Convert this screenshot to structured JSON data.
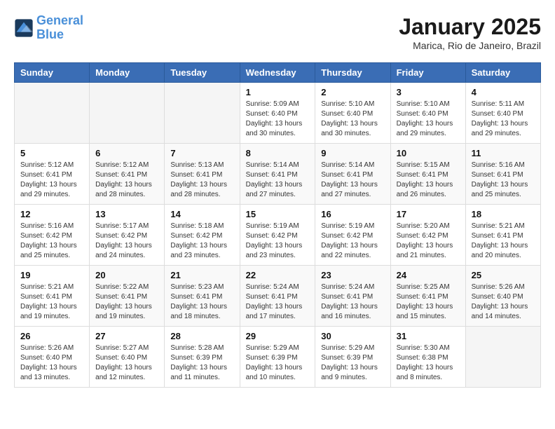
{
  "header": {
    "logo_line1": "General",
    "logo_line2": "Blue",
    "month_title": "January 2025",
    "location": "Marica, Rio de Janeiro, Brazil"
  },
  "weekdays": [
    "Sunday",
    "Monday",
    "Tuesday",
    "Wednesday",
    "Thursday",
    "Friday",
    "Saturday"
  ],
  "weeks": [
    [
      {
        "day": "",
        "sunrise": "",
        "sunset": "",
        "daylight": ""
      },
      {
        "day": "",
        "sunrise": "",
        "sunset": "",
        "daylight": ""
      },
      {
        "day": "",
        "sunrise": "",
        "sunset": "",
        "daylight": ""
      },
      {
        "day": "1",
        "sunrise": "Sunrise: 5:09 AM",
        "sunset": "Sunset: 6:40 PM",
        "daylight": "Daylight: 13 hours and 30 minutes."
      },
      {
        "day": "2",
        "sunrise": "Sunrise: 5:10 AM",
        "sunset": "Sunset: 6:40 PM",
        "daylight": "Daylight: 13 hours and 30 minutes."
      },
      {
        "day": "3",
        "sunrise": "Sunrise: 5:10 AM",
        "sunset": "Sunset: 6:40 PM",
        "daylight": "Daylight: 13 hours and 29 minutes."
      },
      {
        "day": "4",
        "sunrise": "Sunrise: 5:11 AM",
        "sunset": "Sunset: 6:40 PM",
        "daylight": "Daylight: 13 hours and 29 minutes."
      }
    ],
    [
      {
        "day": "5",
        "sunrise": "Sunrise: 5:12 AM",
        "sunset": "Sunset: 6:41 PM",
        "daylight": "Daylight: 13 hours and 29 minutes."
      },
      {
        "day": "6",
        "sunrise": "Sunrise: 5:12 AM",
        "sunset": "Sunset: 6:41 PM",
        "daylight": "Daylight: 13 hours and 28 minutes."
      },
      {
        "day": "7",
        "sunrise": "Sunrise: 5:13 AM",
        "sunset": "Sunset: 6:41 PM",
        "daylight": "Daylight: 13 hours and 28 minutes."
      },
      {
        "day": "8",
        "sunrise": "Sunrise: 5:14 AM",
        "sunset": "Sunset: 6:41 PM",
        "daylight": "Daylight: 13 hours and 27 minutes."
      },
      {
        "day": "9",
        "sunrise": "Sunrise: 5:14 AM",
        "sunset": "Sunset: 6:41 PM",
        "daylight": "Daylight: 13 hours and 27 minutes."
      },
      {
        "day": "10",
        "sunrise": "Sunrise: 5:15 AM",
        "sunset": "Sunset: 6:41 PM",
        "daylight": "Daylight: 13 hours and 26 minutes."
      },
      {
        "day": "11",
        "sunrise": "Sunrise: 5:16 AM",
        "sunset": "Sunset: 6:41 PM",
        "daylight": "Daylight: 13 hours and 25 minutes."
      }
    ],
    [
      {
        "day": "12",
        "sunrise": "Sunrise: 5:16 AM",
        "sunset": "Sunset: 6:42 PM",
        "daylight": "Daylight: 13 hours and 25 minutes."
      },
      {
        "day": "13",
        "sunrise": "Sunrise: 5:17 AM",
        "sunset": "Sunset: 6:42 PM",
        "daylight": "Daylight: 13 hours and 24 minutes."
      },
      {
        "day": "14",
        "sunrise": "Sunrise: 5:18 AM",
        "sunset": "Sunset: 6:42 PM",
        "daylight": "Daylight: 13 hours and 23 minutes."
      },
      {
        "day": "15",
        "sunrise": "Sunrise: 5:19 AM",
        "sunset": "Sunset: 6:42 PM",
        "daylight": "Daylight: 13 hours and 23 minutes."
      },
      {
        "day": "16",
        "sunrise": "Sunrise: 5:19 AM",
        "sunset": "Sunset: 6:42 PM",
        "daylight": "Daylight: 13 hours and 22 minutes."
      },
      {
        "day": "17",
        "sunrise": "Sunrise: 5:20 AM",
        "sunset": "Sunset: 6:42 PM",
        "daylight": "Daylight: 13 hours and 21 minutes."
      },
      {
        "day": "18",
        "sunrise": "Sunrise: 5:21 AM",
        "sunset": "Sunset: 6:41 PM",
        "daylight": "Daylight: 13 hours and 20 minutes."
      }
    ],
    [
      {
        "day": "19",
        "sunrise": "Sunrise: 5:21 AM",
        "sunset": "Sunset: 6:41 PM",
        "daylight": "Daylight: 13 hours and 19 minutes."
      },
      {
        "day": "20",
        "sunrise": "Sunrise: 5:22 AM",
        "sunset": "Sunset: 6:41 PM",
        "daylight": "Daylight: 13 hours and 19 minutes."
      },
      {
        "day": "21",
        "sunrise": "Sunrise: 5:23 AM",
        "sunset": "Sunset: 6:41 PM",
        "daylight": "Daylight: 13 hours and 18 minutes."
      },
      {
        "day": "22",
        "sunrise": "Sunrise: 5:24 AM",
        "sunset": "Sunset: 6:41 PM",
        "daylight": "Daylight: 13 hours and 17 minutes."
      },
      {
        "day": "23",
        "sunrise": "Sunrise: 5:24 AM",
        "sunset": "Sunset: 6:41 PM",
        "daylight": "Daylight: 13 hours and 16 minutes."
      },
      {
        "day": "24",
        "sunrise": "Sunrise: 5:25 AM",
        "sunset": "Sunset: 6:41 PM",
        "daylight": "Daylight: 13 hours and 15 minutes."
      },
      {
        "day": "25",
        "sunrise": "Sunrise: 5:26 AM",
        "sunset": "Sunset: 6:40 PM",
        "daylight": "Daylight: 13 hours and 14 minutes."
      }
    ],
    [
      {
        "day": "26",
        "sunrise": "Sunrise: 5:26 AM",
        "sunset": "Sunset: 6:40 PM",
        "daylight": "Daylight: 13 hours and 13 minutes."
      },
      {
        "day": "27",
        "sunrise": "Sunrise: 5:27 AM",
        "sunset": "Sunset: 6:40 PM",
        "daylight": "Daylight: 13 hours and 12 minutes."
      },
      {
        "day": "28",
        "sunrise": "Sunrise: 5:28 AM",
        "sunset": "Sunset: 6:39 PM",
        "daylight": "Daylight: 13 hours and 11 minutes."
      },
      {
        "day": "29",
        "sunrise": "Sunrise: 5:29 AM",
        "sunset": "Sunset: 6:39 PM",
        "daylight": "Daylight: 13 hours and 10 minutes."
      },
      {
        "day": "30",
        "sunrise": "Sunrise: 5:29 AM",
        "sunset": "Sunset: 6:39 PM",
        "daylight": "Daylight: 13 hours and 9 minutes."
      },
      {
        "day": "31",
        "sunrise": "Sunrise: 5:30 AM",
        "sunset": "Sunset: 6:38 PM",
        "daylight": "Daylight: 13 hours and 8 minutes."
      },
      {
        "day": "",
        "sunrise": "",
        "sunset": "",
        "daylight": ""
      }
    ]
  ]
}
